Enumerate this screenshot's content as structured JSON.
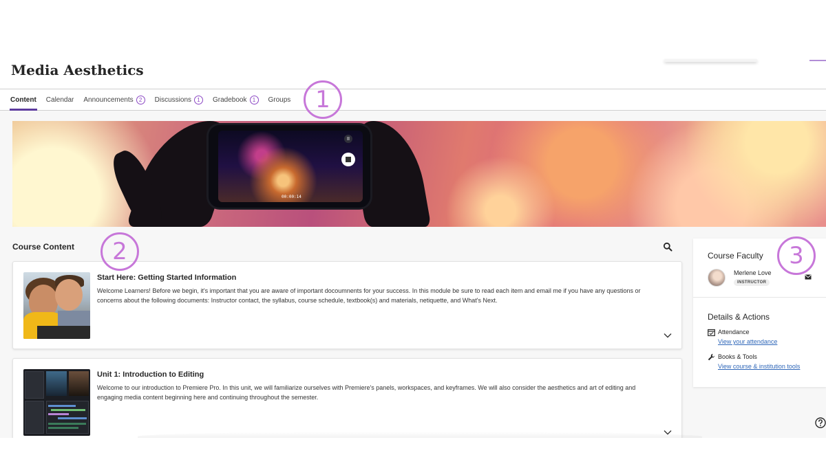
{
  "course": {
    "title": "Media Aesthetics"
  },
  "nav": {
    "tabs": [
      {
        "label": "Content",
        "badge": null,
        "active": true
      },
      {
        "label": "Calendar",
        "badge": null,
        "active": false
      },
      {
        "label": "Announcements",
        "badge": "2",
        "active": false
      },
      {
        "label": "Discussions",
        "badge": "1",
        "active": false
      },
      {
        "label": "Gradebook",
        "badge": "1",
        "active": false
      },
      {
        "label": "Groups",
        "badge": null,
        "active": false
      }
    ]
  },
  "callouts": {
    "one": "1",
    "two": "2",
    "three": "3"
  },
  "banner": {
    "phone_time": "00:00:14",
    "phone_pause": "II"
  },
  "content": {
    "heading": "Course Content",
    "modules": [
      {
        "title": "Start Here: Getting Started Information",
        "description": "Welcome Learners! Before we begin, it's important that you are aware of important docoumnents for your success. In this module be sure to read each item and email me if you have any questions or concerns about the following documents: Instructor contact, the syllabus, course schedule, textbook(s) and materials, netiquette, and What's Next."
      },
      {
        "title": "Unit 1: Introduction to Editing",
        "description": "Welcome to our introduction to Premiere Pro. In this unit, we will familiarize ourselves with Premiere's panels, workspaces, and keyframes. We will also consider the aesthetics and art of editing and engaging media content beginning here and continuing throughout the semester."
      }
    ]
  },
  "sidebar": {
    "faculty_heading": "Course Faculty",
    "faculty": {
      "name": "Merlene Love",
      "role": "INSTRUCTOR"
    },
    "details_heading": "Details & Actions",
    "items": [
      {
        "label": "Attendance",
        "link": "View your attendance"
      },
      {
        "label": "Books & Tools",
        "link": "View course & institution tools"
      }
    ]
  },
  "colors": {
    "accent": "#5c3a9e",
    "callout": "#c777d9",
    "link": "#2e66b8",
    "badge": "#8b47c4"
  }
}
